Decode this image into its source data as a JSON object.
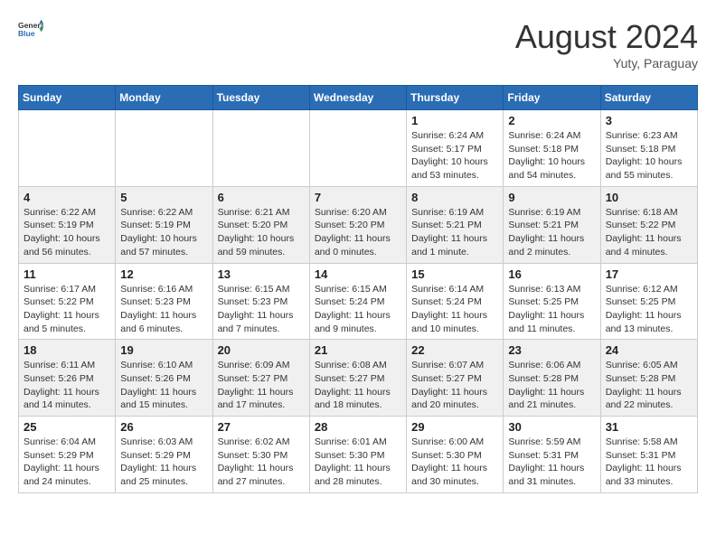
{
  "header": {
    "logo_general": "General",
    "logo_blue": "Blue",
    "month_year": "August 2024",
    "location": "Yuty, Paraguay"
  },
  "weekdays": [
    "Sunday",
    "Monday",
    "Tuesday",
    "Wednesday",
    "Thursday",
    "Friday",
    "Saturday"
  ],
  "weeks": [
    [
      {
        "day": "",
        "info": ""
      },
      {
        "day": "",
        "info": ""
      },
      {
        "day": "",
        "info": ""
      },
      {
        "day": "",
        "info": ""
      },
      {
        "day": "1",
        "info": "Sunrise: 6:24 AM\nSunset: 5:17 PM\nDaylight: 10 hours\nand 53 minutes."
      },
      {
        "day": "2",
        "info": "Sunrise: 6:24 AM\nSunset: 5:18 PM\nDaylight: 10 hours\nand 54 minutes."
      },
      {
        "day": "3",
        "info": "Sunrise: 6:23 AM\nSunset: 5:18 PM\nDaylight: 10 hours\nand 55 minutes."
      }
    ],
    [
      {
        "day": "4",
        "info": "Sunrise: 6:22 AM\nSunset: 5:19 PM\nDaylight: 10 hours\nand 56 minutes."
      },
      {
        "day": "5",
        "info": "Sunrise: 6:22 AM\nSunset: 5:19 PM\nDaylight: 10 hours\nand 57 minutes."
      },
      {
        "day": "6",
        "info": "Sunrise: 6:21 AM\nSunset: 5:20 PM\nDaylight: 10 hours\nand 59 minutes."
      },
      {
        "day": "7",
        "info": "Sunrise: 6:20 AM\nSunset: 5:20 PM\nDaylight: 11 hours\nand 0 minutes."
      },
      {
        "day": "8",
        "info": "Sunrise: 6:19 AM\nSunset: 5:21 PM\nDaylight: 11 hours\nand 1 minute."
      },
      {
        "day": "9",
        "info": "Sunrise: 6:19 AM\nSunset: 5:21 PM\nDaylight: 11 hours\nand 2 minutes."
      },
      {
        "day": "10",
        "info": "Sunrise: 6:18 AM\nSunset: 5:22 PM\nDaylight: 11 hours\nand 4 minutes."
      }
    ],
    [
      {
        "day": "11",
        "info": "Sunrise: 6:17 AM\nSunset: 5:22 PM\nDaylight: 11 hours\nand 5 minutes."
      },
      {
        "day": "12",
        "info": "Sunrise: 6:16 AM\nSunset: 5:23 PM\nDaylight: 11 hours\nand 6 minutes."
      },
      {
        "day": "13",
        "info": "Sunrise: 6:15 AM\nSunset: 5:23 PM\nDaylight: 11 hours\nand 7 minutes."
      },
      {
        "day": "14",
        "info": "Sunrise: 6:15 AM\nSunset: 5:24 PM\nDaylight: 11 hours\nand 9 minutes."
      },
      {
        "day": "15",
        "info": "Sunrise: 6:14 AM\nSunset: 5:24 PM\nDaylight: 11 hours\nand 10 minutes."
      },
      {
        "day": "16",
        "info": "Sunrise: 6:13 AM\nSunset: 5:25 PM\nDaylight: 11 hours\nand 11 minutes."
      },
      {
        "day": "17",
        "info": "Sunrise: 6:12 AM\nSunset: 5:25 PM\nDaylight: 11 hours\nand 13 minutes."
      }
    ],
    [
      {
        "day": "18",
        "info": "Sunrise: 6:11 AM\nSunset: 5:26 PM\nDaylight: 11 hours\nand 14 minutes."
      },
      {
        "day": "19",
        "info": "Sunrise: 6:10 AM\nSunset: 5:26 PM\nDaylight: 11 hours\nand 15 minutes."
      },
      {
        "day": "20",
        "info": "Sunrise: 6:09 AM\nSunset: 5:27 PM\nDaylight: 11 hours\nand 17 minutes."
      },
      {
        "day": "21",
        "info": "Sunrise: 6:08 AM\nSunset: 5:27 PM\nDaylight: 11 hours\nand 18 minutes."
      },
      {
        "day": "22",
        "info": "Sunrise: 6:07 AM\nSunset: 5:27 PM\nDaylight: 11 hours\nand 20 minutes."
      },
      {
        "day": "23",
        "info": "Sunrise: 6:06 AM\nSunset: 5:28 PM\nDaylight: 11 hours\nand 21 minutes."
      },
      {
        "day": "24",
        "info": "Sunrise: 6:05 AM\nSunset: 5:28 PM\nDaylight: 11 hours\nand 22 minutes."
      }
    ],
    [
      {
        "day": "25",
        "info": "Sunrise: 6:04 AM\nSunset: 5:29 PM\nDaylight: 11 hours\nand 24 minutes."
      },
      {
        "day": "26",
        "info": "Sunrise: 6:03 AM\nSunset: 5:29 PM\nDaylight: 11 hours\nand 25 minutes."
      },
      {
        "day": "27",
        "info": "Sunrise: 6:02 AM\nSunset: 5:30 PM\nDaylight: 11 hours\nand 27 minutes."
      },
      {
        "day": "28",
        "info": "Sunrise: 6:01 AM\nSunset: 5:30 PM\nDaylight: 11 hours\nand 28 minutes."
      },
      {
        "day": "29",
        "info": "Sunrise: 6:00 AM\nSunset: 5:30 PM\nDaylight: 11 hours\nand 30 minutes."
      },
      {
        "day": "30",
        "info": "Sunrise: 5:59 AM\nSunset: 5:31 PM\nDaylight: 11 hours\nand 31 minutes."
      },
      {
        "day": "31",
        "info": "Sunrise: 5:58 AM\nSunset: 5:31 PM\nDaylight: 11 hours\nand 33 minutes."
      }
    ]
  ]
}
